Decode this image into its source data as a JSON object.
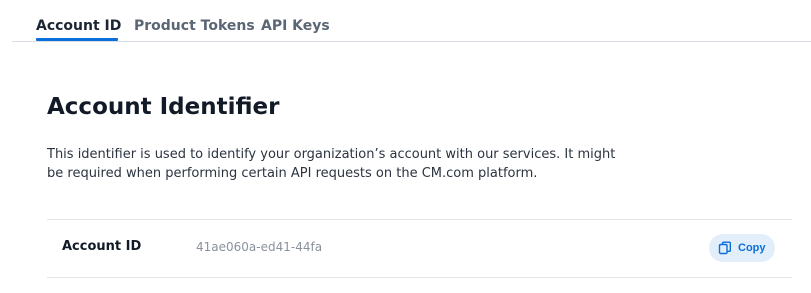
{
  "tabs": [
    {
      "label": "Account ID",
      "active": true
    },
    {
      "label": "Product Tokens",
      "active": false
    },
    {
      "label": "API Keys",
      "active": false
    }
  ],
  "header": {
    "title": "Account Identifier",
    "description": "This identifier is used to identify your organization’s account with our services. It might be required when performing certain API requests on the CM.com platform."
  },
  "account": {
    "label": "Account ID",
    "value": "41ae060a-ed41-44fa",
    "copy_label": "Copy",
    "copy_icon": "copy-icon"
  },
  "colors": {
    "accent": "#0a6fd8",
    "copy_button_bg": "#e3eefb",
    "divider": "#d9dde3"
  }
}
